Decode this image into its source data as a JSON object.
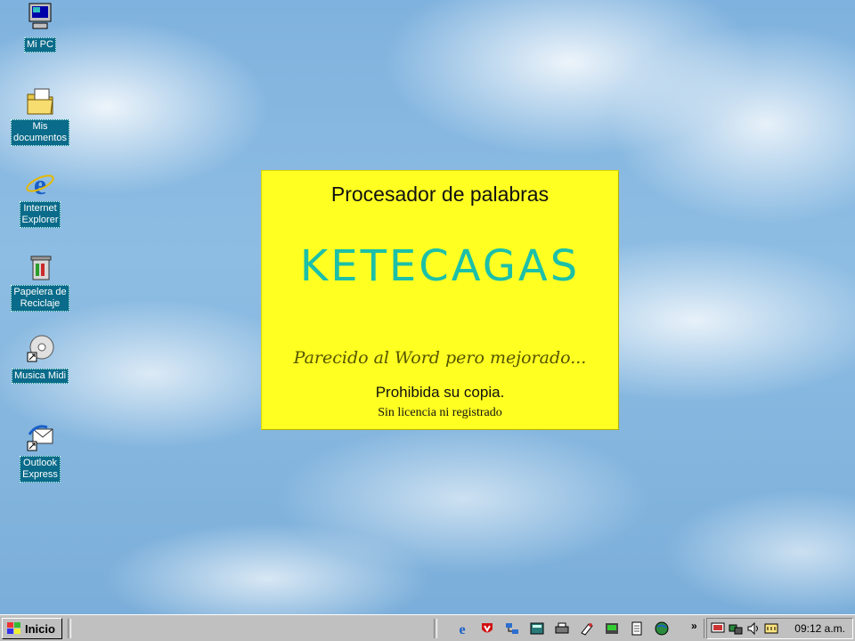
{
  "desktop": {
    "icons": [
      {
        "label": "Mi PC"
      },
      {
        "label": "Mis\ndocumentos"
      },
      {
        "label": "Internet\nExplorer"
      },
      {
        "label": "Papelera de\nReciclaje"
      },
      {
        "label": "Musica Midi"
      },
      {
        "label": "Outlook\nExpress"
      }
    ]
  },
  "splash": {
    "subtitle": "Procesador  de palabras",
    "title": "KETECAGAS",
    "tagline": "Parecido al Word pero mejorado...",
    "notice": "Prohibida su copia.",
    "license": "Sin licencia ni  registrado",
    "background_color": "#ffff22",
    "title_color": "#1cc0a8"
  },
  "taskbar": {
    "start_label": "Inicio",
    "quick_launch": [
      "internet-explorer-icon",
      "antivirus-icon",
      "network-icon",
      "calculator-icon",
      "printer-icon",
      "paint-icon",
      "media-icon",
      "notepad-icon",
      "globe-icon"
    ],
    "tray_icons": [
      "monitor-icon",
      "network-tray-icon",
      "volume-icon",
      "keyboard-icon"
    ],
    "clock": "09:12 a.m."
  }
}
